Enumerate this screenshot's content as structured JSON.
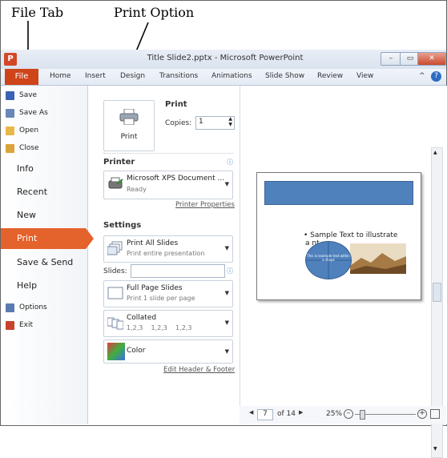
{
  "annotations": {
    "file_tab": "File Tab",
    "print_option": "Print Option"
  },
  "window": {
    "title": "Title Slide2.pptx - Microsoft PowerPoint",
    "logo": "P",
    "controls": {
      "minimize": "–",
      "maximize": "▭",
      "close": "✕"
    }
  },
  "ribbon": {
    "file": "File",
    "tabs": [
      "Home",
      "Insert",
      "Design",
      "Transitions",
      "Animations",
      "Slide Show",
      "Review",
      "View"
    ],
    "collapse": "^",
    "help": "?"
  },
  "nav": {
    "small_top": [
      {
        "label": "Save",
        "icon": "save-icon",
        "color": "#3a63b5"
      },
      {
        "label": "Save As",
        "icon": "save-as-icon",
        "color": "#6b87b8"
      },
      {
        "label": "Open",
        "icon": "open-folder-icon",
        "color": "#e8b84a"
      },
      {
        "label": "Close",
        "icon": "close-folder-icon",
        "color": "#d9a53a"
      }
    ],
    "big": [
      "Info",
      "Recent",
      "New",
      "Print",
      "Save & Send",
      "Help"
    ],
    "small_bottom": [
      {
        "label": "Options",
        "icon": "options-icon",
        "color": "#5b7ab0"
      },
      {
        "label": "Exit",
        "icon": "exit-icon",
        "color": "#c8432c"
      }
    ]
  },
  "print": {
    "heading": "Print",
    "button_label": "Print",
    "copies_label": "Copies:",
    "copies_value": "1",
    "printer_heading": "Printer",
    "printer_name": "Microsoft XPS Document ...",
    "printer_status": "Ready",
    "printer_properties": "Printer Properties",
    "settings_heading": "Settings",
    "slides_label": "Slides:",
    "info_glyph": "ⓘ",
    "dropdowns": [
      {
        "main": "Print All Slides",
        "sub": "Print entire presentation",
        "icon": "slides-stack-icon"
      },
      {
        "main": "Full Page Slides",
        "sub": "Print 1 slide per page",
        "icon": "full-page-icon"
      },
      {
        "main": "Collated",
        "sub": "1,2,3    1,2,3    1,2,3",
        "icon": "collated-icon"
      },
      {
        "main": "Color",
        "sub": "",
        "icon": "color-swatch-icon"
      }
    ],
    "edit_link": "Edit Header & Footer"
  },
  "preview": {
    "slide_text": "• Sample Text to illustrate",
    "slide_text_2": "a          nt",
    "oval_text": "This is example text within a shape"
  },
  "status": {
    "page": "7",
    "of": "of 14",
    "zoom": "25%"
  },
  "colors": {
    "file_tab": "#cf4419",
    "print_active": "#e4622b",
    "slide_shape": "#4f81bd"
  }
}
